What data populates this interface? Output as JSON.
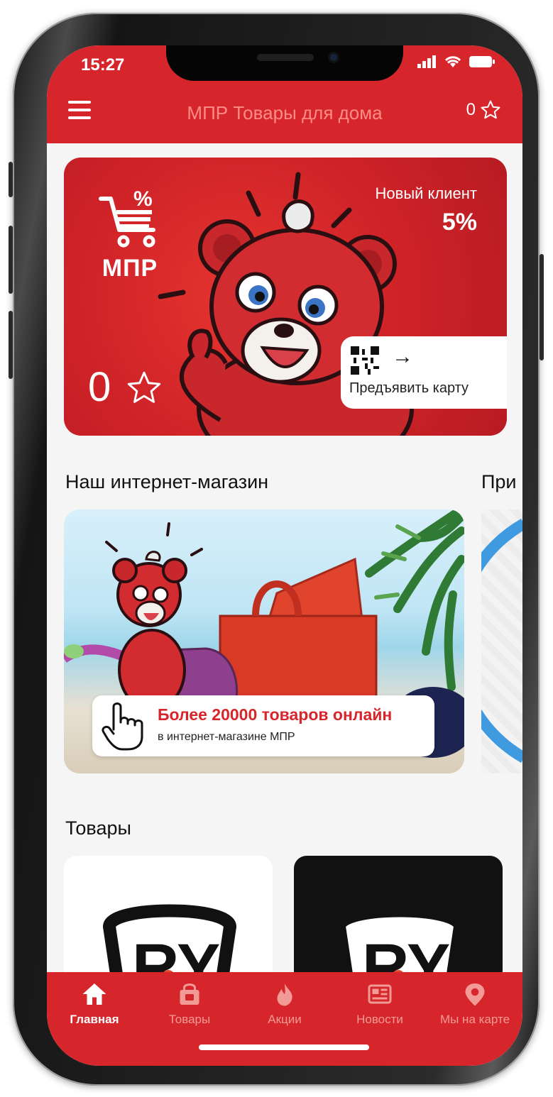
{
  "status": {
    "time": "15:27"
  },
  "header": {
    "title": "МПР Товары для дома",
    "points": "0"
  },
  "loyalty": {
    "logo": "МПР",
    "client_type": "Новый клиент",
    "discount": "5%",
    "points": "0",
    "show_card_label": "Предъявить карту"
  },
  "sections": {
    "online_store": "Наш интернет-магазин",
    "next_peek": "При",
    "products": "Товары"
  },
  "promo": {
    "title": "Более 20000 товаров онлайн",
    "subtitle": "в интернет-магазине МПР"
  },
  "tabs": [
    {
      "label": "Главная",
      "icon": "home-icon",
      "active": true
    },
    {
      "label": "Товары",
      "icon": "bag-icon",
      "active": false
    },
    {
      "label": "Акции",
      "icon": "fire-icon",
      "active": false
    },
    {
      "label": "Новости",
      "icon": "news-icon",
      "active": false
    },
    {
      "label": "Мы на карте",
      "icon": "map-pin-icon",
      "active": false
    }
  ],
  "colors": {
    "brand_red": "#d7262b",
    "inactive_tab": "#f29a96"
  }
}
